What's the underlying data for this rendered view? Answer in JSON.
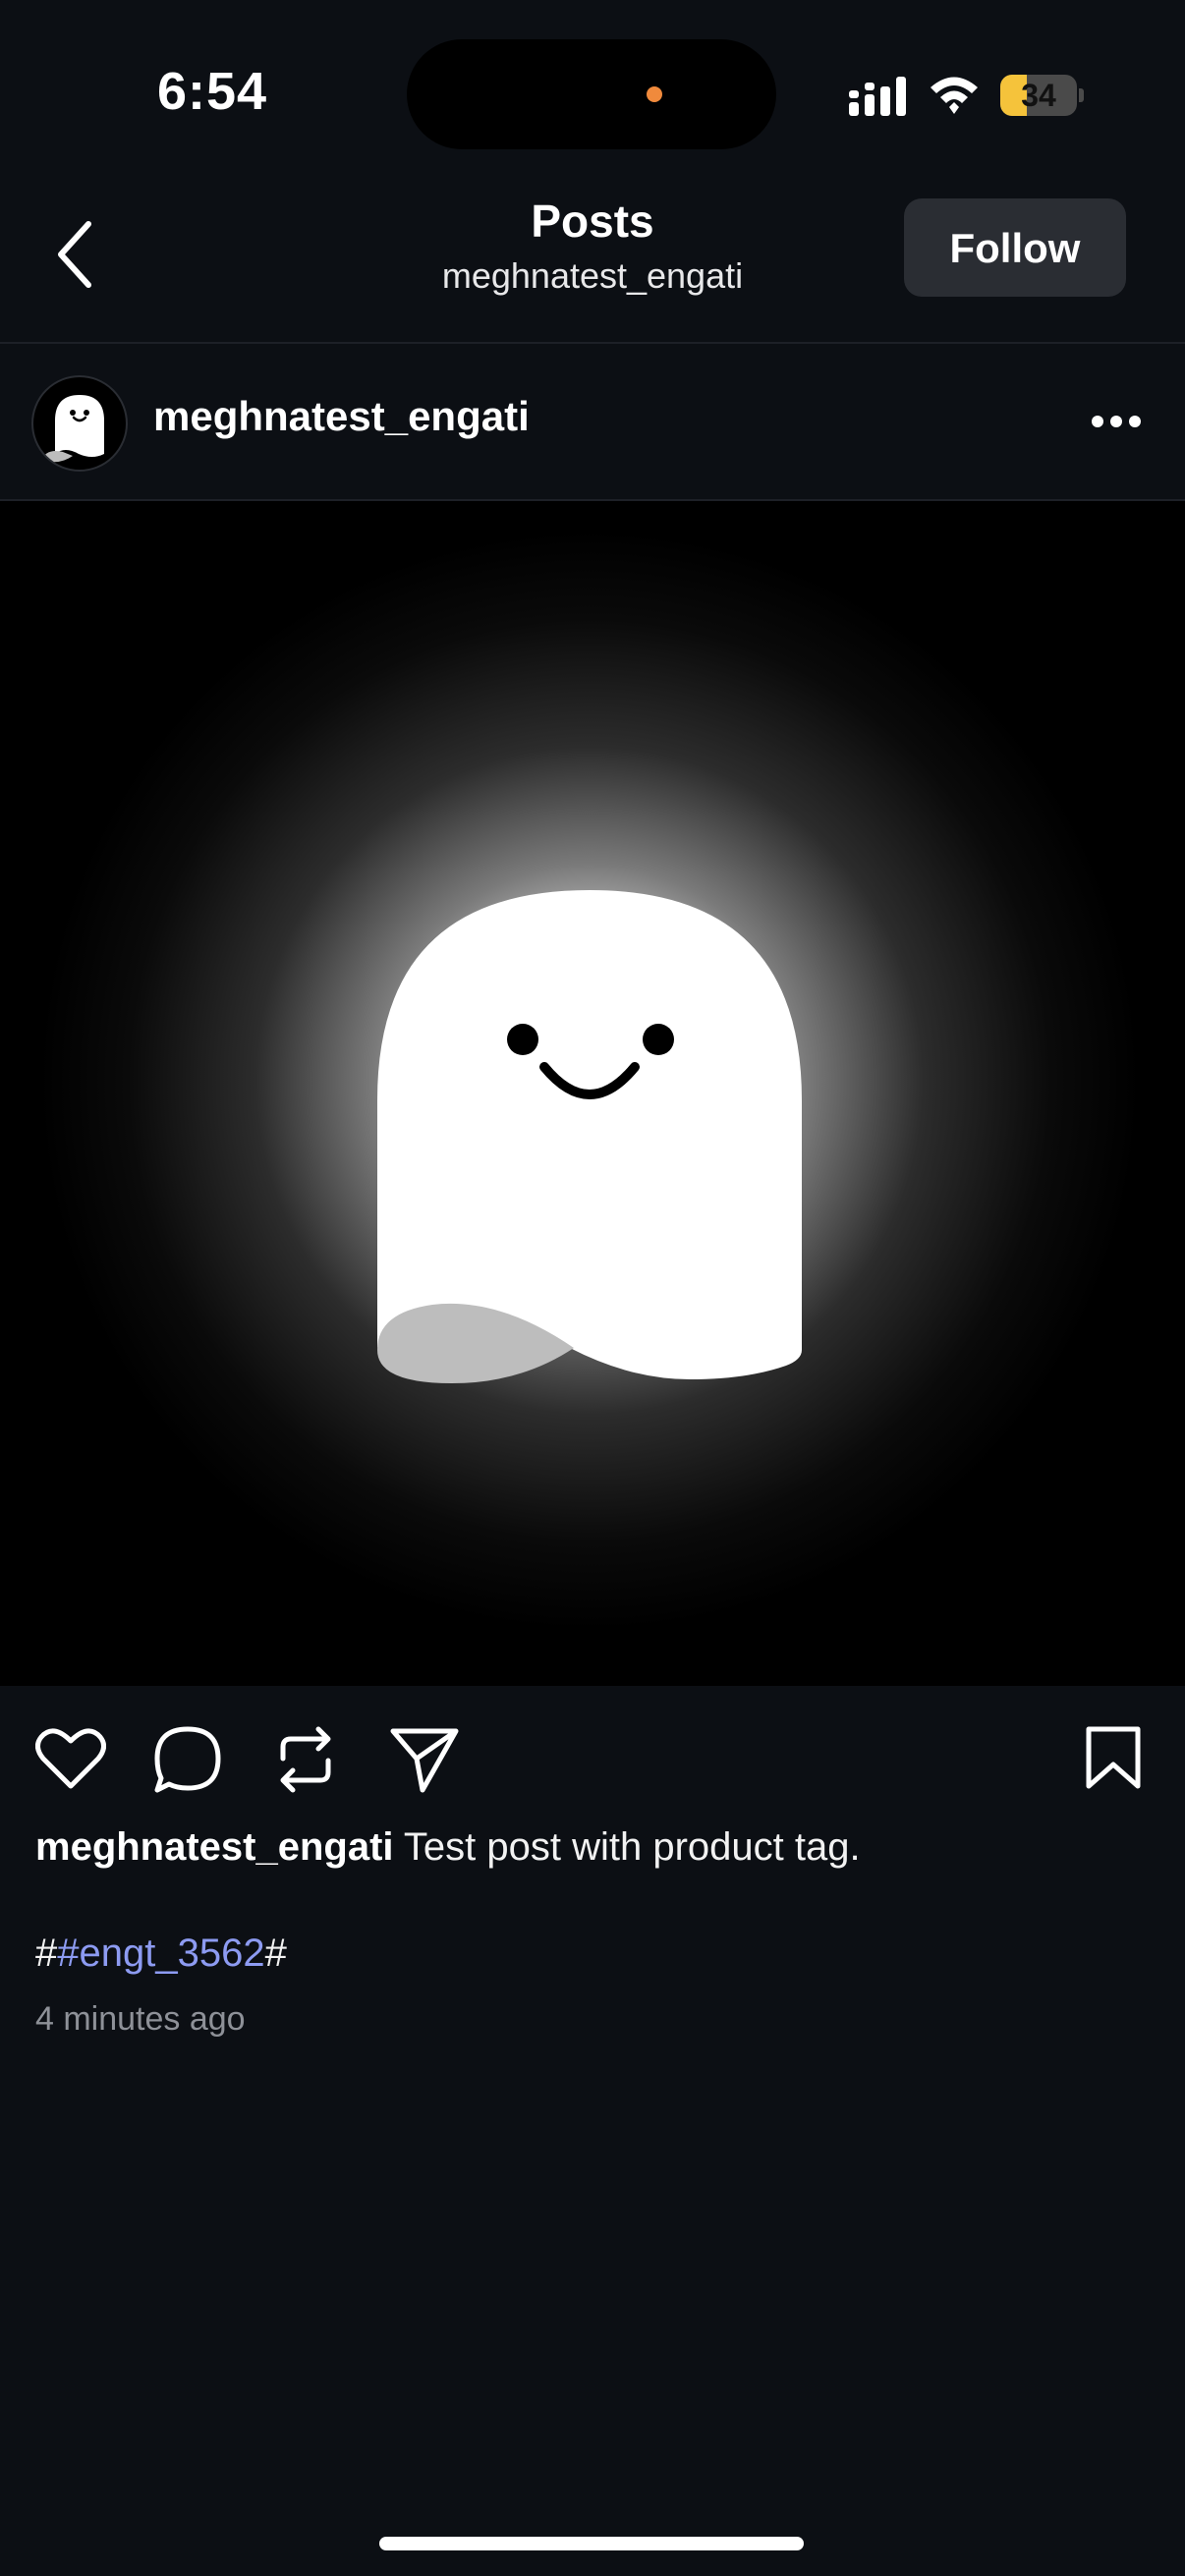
{
  "status_bar": {
    "time": "6:54",
    "battery_level": "34",
    "battery_fraction": 0.34,
    "icons": [
      "signal-icon",
      "wifi-icon",
      "battery-icon"
    ]
  },
  "nav": {
    "title": "Posts",
    "subtitle": "meghnatest_engati",
    "follow_label": "Follow",
    "back_icon": "chevron-left-icon"
  },
  "post": {
    "username": "meghnatest_engati",
    "more_icon": "ellipsis-icon",
    "image_icon": "ghost-avatar",
    "actions": [
      "heart-icon",
      "comment-icon",
      "repost-icon",
      "share-icon",
      "bookmark-icon"
    ],
    "caption_user": "meghnatest_engati",
    "caption_text": " Test post with product tag.",
    "hashtag_prefix": "#",
    "hashtag": "#engt_3562",
    "hashtag_suffix": "#",
    "timestamp": "4 minutes ago"
  },
  "colors": {
    "background": "#0c0f14",
    "accent_link": "#8d9bf2",
    "button_bg": "#2a2d33",
    "battery": "#f5c33b"
  }
}
